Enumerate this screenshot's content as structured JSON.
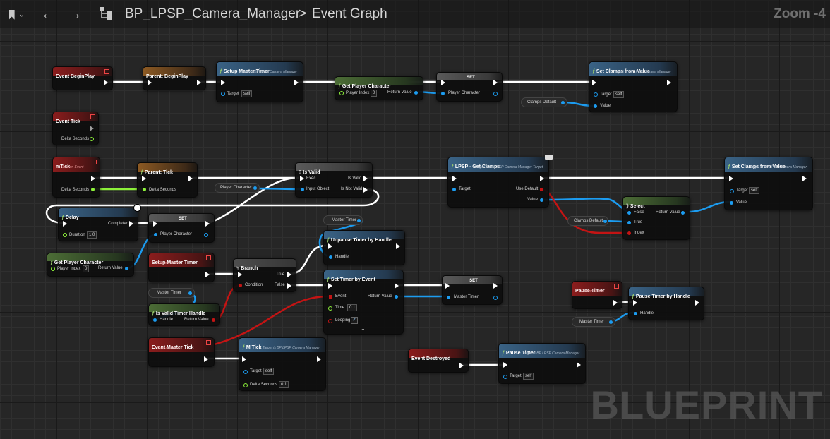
{
  "toolbar": {
    "bookmark_icon": "bookmark-icon",
    "breadcrumb_blueprint": "BP_LPSP_Camera_Manager",
    "breadcrumb_separator": ">",
    "breadcrumb_graph": "Event Graph",
    "zoom": "Zoom -4"
  },
  "watermark": "BLUEPRINT",
  "colors": {
    "exec": "#ffffff",
    "object": "#1c9cf0",
    "bool": "#c41414",
    "float": "#8df13a",
    "event_header": "#8b1d1d",
    "function_header": "#3a6386"
  },
  "nodes": {
    "event_beginplay": {
      "title": "Event BeginPlay"
    },
    "parent_beginplay": {
      "title": "Parent: BeginPlay"
    },
    "setup_master_timer_call": {
      "title": "Setup Master Timer",
      "sub": "Target is BP LPSP Camera Manager",
      "target": "Target",
      "target_val": "self"
    },
    "get_player_character_1": {
      "title": "Get Player Character",
      "player_index": "Player Index",
      "player_index_val": "0",
      "return": "Return Value"
    },
    "set_1": {
      "title": "SET",
      "pin": "Player Character"
    },
    "set_clamps_1": {
      "title": "Set Clamps from Value",
      "sub": "Target is BP LPSP Camera Manager",
      "target": "Target",
      "target_val": "self",
      "value": "Value"
    },
    "clamps_default_1": {
      "label": "Clamps Default"
    },
    "event_tick": {
      "title": "Event Tick",
      "delta": "Delta Seconds"
    },
    "m_tick_event": {
      "title": "mTick",
      "sub": "Custom Event",
      "delta": "Delta Seconds"
    },
    "parent_tick": {
      "title": "Parent: Tick",
      "delta": "Delta Seconds"
    },
    "is_valid": {
      "title": "Is Valid",
      "exec": "Exec",
      "input": "Input Object",
      "is_valid": "Is Valid",
      "is_not_valid": "Is Not Valid"
    },
    "player_character_var_1": {
      "label": "Player Character"
    },
    "lpsp_get_clamps": {
      "title": "LPSP - Get Clamps",
      "sub": "Target is BP LPSP Camera Manager Target",
      "target": "Target",
      "use_default": "Use Default",
      "value": "Value"
    },
    "set_clamps_2": {
      "title": "Set Clamps from Value",
      "sub": "Target is BP LPSP Camera Manager",
      "target": "Target",
      "target_val": "self",
      "value": "Value"
    },
    "select": {
      "title": "Select",
      "false": "False",
      "true": "True",
      "index": "Index",
      "return": "Return Value"
    },
    "clamps_default_2": {
      "label": "Clamps Default"
    },
    "delay": {
      "title": "Delay",
      "completed": "Completed",
      "duration": "Duration",
      "duration_val": "1.0"
    },
    "set_2": {
      "title": "SET",
      "pin": "Player Character"
    },
    "get_player_character_2": {
      "title": "Get Player Character",
      "player_index": "Player Index",
      "player_index_val": "0",
      "return": "Return Value"
    },
    "master_timer_var_1": {
      "label": "Master Timer"
    },
    "unpause_timer": {
      "title": "Unpause Timer by Handle",
      "handle": "Handle"
    },
    "setup_master_timer_event": {
      "title": "Setup Master Timer",
      "sub": "Custom Event"
    },
    "branch": {
      "title": "Branch",
      "condition": "Condition",
      "true": "True",
      "false": "False"
    },
    "set_timer_by_event": {
      "title": "Set Timer by Event",
      "event": "Event",
      "time": "Time",
      "time_val": "0.1",
      "looping": "Looping",
      "return": "Return Value"
    },
    "set_3": {
      "title": "SET",
      "pin": "Master Timer"
    },
    "master_timer_var_2": {
      "label": "Master Timer"
    },
    "is_valid_timer_handle": {
      "title": "Is Valid Timer Handle",
      "handle": "Handle",
      "return": "Return Value"
    },
    "pause_timer_event": {
      "title": "Pause Timer",
      "sub": "Custom Event"
    },
    "pause_timer_by_handle": {
      "title": "Pause Timer by Handle",
      "handle": "Handle"
    },
    "master_timer_var_3": {
      "label": "Master Timer"
    },
    "event_master_tick": {
      "title": "Event Master Tick",
      "sub": "Custom Event"
    },
    "m_tick_call": {
      "title": "M Tick",
      "sub": "Target is BP LPSP Camera Manager",
      "target": "Target",
      "target_val": "self",
      "delta": "Delta Seconds",
      "delta_val": "0.1"
    },
    "event_destroyed": {
      "title": "Event Destroyed"
    },
    "pause_timer_call": {
      "title": "Pause Timer",
      "sub": "Target is BP LPSP Camera Manager",
      "target": "Target",
      "target_val": "self"
    }
  }
}
